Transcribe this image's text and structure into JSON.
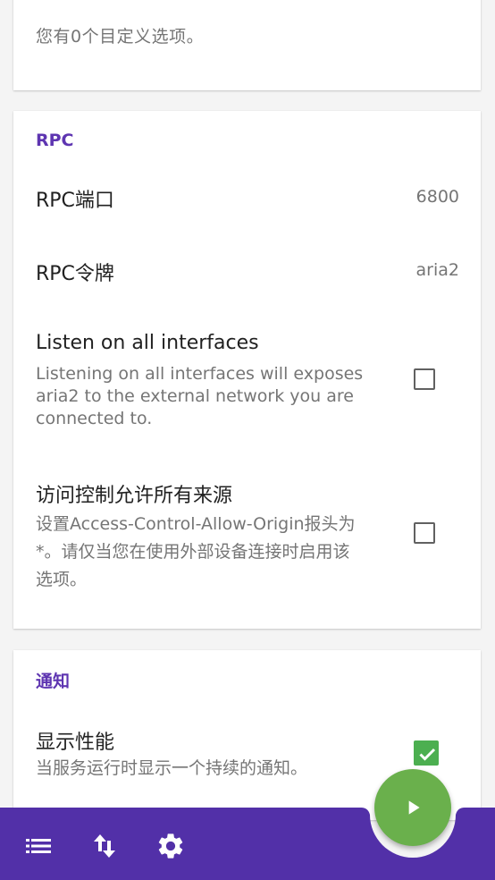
{
  "top_card": {
    "summary_cut": "您有0个目定义选项。"
  },
  "rpc": {
    "section_title": "RPC",
    "port": {
      "title": "RPC端口",
      "value": "6800"
    },
    "token": {
      "title": "RPC令牌",
      "value": "aria2"
    },
    "listen_all": {
      "title": "Listen on all interfaces",
      "summary_lines": [
        "Listening on all interfaces will exposes",
        "aria2 to the external network you are",
        "connected to."
      ],
      "checked": false
    },
    "allow_origin": {
      "title": "访问控制允许所有来源",
      "summary_lines": [
        "设置Access-Control-Allow-Origin报头为",
        "*。请仅当您在使用外部设备连接时启用该",
        "选项。"
      ],
      "checked": false
    }
  },
  "notifications": {
    "section_title": "通知",
    "show_performance": {
      "title": "显示性能",
      "summary": "当服务运行时显示一个持续的通知。",
      "checked": true
    }
  },
  "bottom_bar": {
    "icons": [
      "list-icon",
      "swap-vert-icon",
      "settings-icon"
    ],
    "fab_icon": "play-icon"
  },
  "colors": {
    "accent": "#5e35b1",
    "bar": "#5230a8",
    "fab": "#6ab04c",
    "check": "#4caf50"
  }
}
